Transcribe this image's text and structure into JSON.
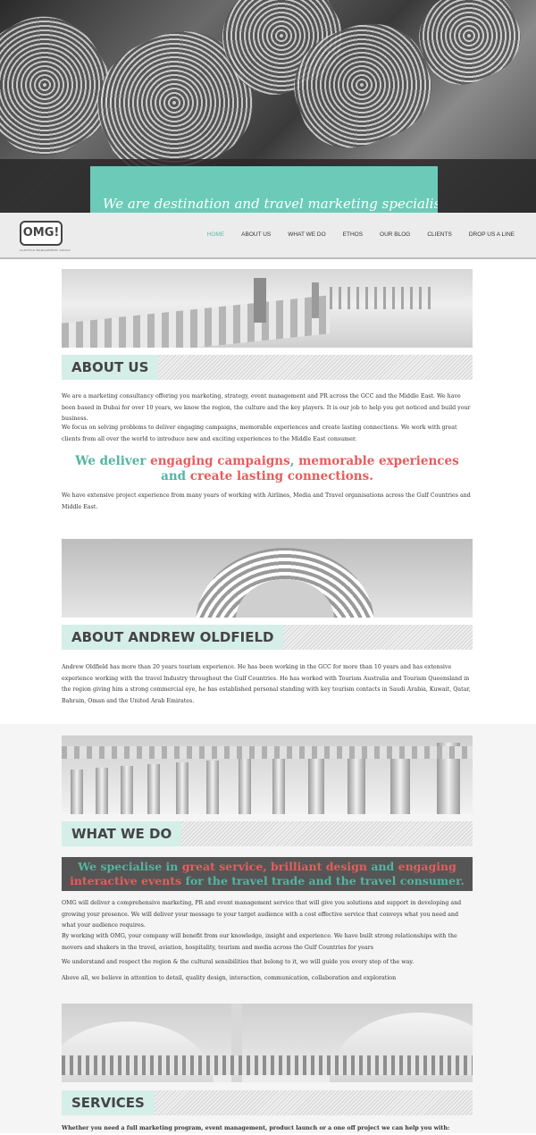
{
  "hero": {
    "banner_text": "We are destination and travel marketing specialists"
  },
  "nav": {
    "logo_text": "OMG!",
    "logo_sub": "OLDFIELD MANAGEMENT GROUP",
    "items": [
      "HOME",
      "ABOUT US",
      "WHAT WE DO",
      "ETHOS",
      "OUR BLOG",
      "CLIENTS",
      "DROP US A LINE"
    ],
    "active": "HOME"
  },
  "about": {
    "title": "ABOUT US",
    "p1": "We are a marketing consultancy offering you marketing, strategy, event management and PR across the GCC and the Middle East. We have been based in Dubai for over 10 years, we know the region, the culture and the key players. It is our job to help you get noticed and build your business.",
    "p2": "We focus on solving problems to deliver engaging campaigns, memorable experiences and create lasting connections. We work with great clients from all over the world to introduce new and exciting experiences to the Middle East consumer.",
    "tag": {
      "a": "We deliver ",
      "b": "engaging campaigns",
      "c": ", ",
      "d": "memorable experiences",
      "e": "and ",
      "f": "create lasting connections."
    },
    "p3": "We have extensive project experience from many years of working with Airlines, Media and Travel organisations across the Gulf Countries and Middle East."
  },
  "andrew": {
    "title": "ABOUT ANDREW OLDFIELD",
    "p1": "Andrew Oldfield has more than 20 years tourism experience. He has been working in the GCC for more than 10 years and has extensive experience working with the travel Industry throughout the Gulf Countries. He has worked with Tourism Australia and Tourism Queensland in the region giving him a strong commercial eye, he has established personal standing with key tourism contacts in Saudi Arabia, Kuwait, Qatar, Bahrain, Oman and the United Arab Emirates."
  },
  "whatwedo": {
    "title": "WHAT WE DO",
    "callout": {
      "a": "We specialise in ",
      "b": "great service, brilliant design ",
      "c": "and ",
      "d": "engaging interactive events ",
      "e": "for the travel trade and the travel consumer."
    },
    "p1": "OMG will deliver a comprehensive marketing, PR and event management service that will give you solutions and support in developing and growing your presence. We will deliver your message to your target audience with a cost effective service that conveys what you need and what your audience requires.",
    "p2": "By working with OMG, your company will benefit from our knowledge, insight and experience. We have built strong relationships with the movers and shakers in the travel, aviation, hospitality, tourism and media across the Gulf Countries for years",
    "p3": "We understand and respect the region & the cultural sensibilities that belong to it, we will guide you every step of the way.",
    "p4": "Above all, we believe in attention to detail, quality design, interaction, communication, collaboration and exploration"
  },
  "services": {
    "title": "SERVICES",
    "intro": "Whether you need a full marketing program, event management, product launch or a one off project we can help you with:"
  }
}
